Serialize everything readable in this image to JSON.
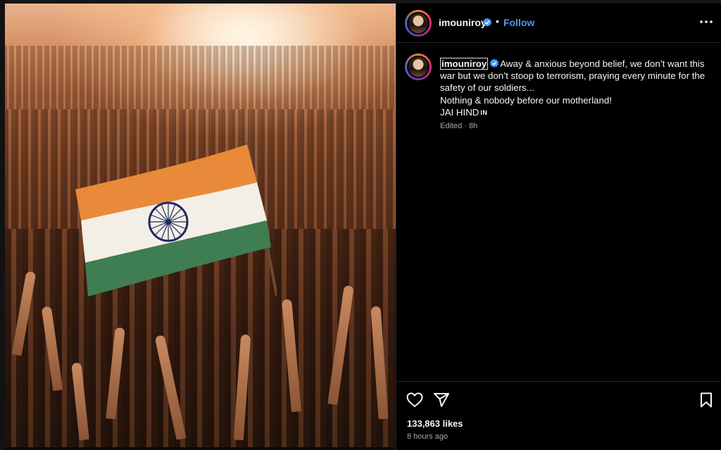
{
  "post": {
    "image_alt_semantic": "flag-over-crowd"
  },
  "header": {
    "username": "imouniroy",
    "separator": "•",
    "follow_label": "Follow"
  },
  "caption": {
    "username": "imouniroy",
    "lines": [
      "Away & anxious beyond belief, we don’t want this war but we don’t stoop to terrorism, praying every minute for the safety of our soldiers...",
      "Nothing & nobody before our motherland!",
      "JAI HIND"
    ],
    "badge": "IN",
    "meta": "Edited · 8h"
  },
  "footer": {
    "likes": "133,863 likes",
    "time": "8 hours ago"
  },
  "icons": {
    "verified": "verified-badge-icon",
    "more": "more-options-icon",
    "like": "heart-icon",
    "share": "share-icon",
    "save": "bookmark-icon"
  },
  "colors": {
    "accent": "#4a9bf7",
    "background": "#000000",
    "text": "#f5f5f5",
    "muted": "#a8a8a8"
  }
}
